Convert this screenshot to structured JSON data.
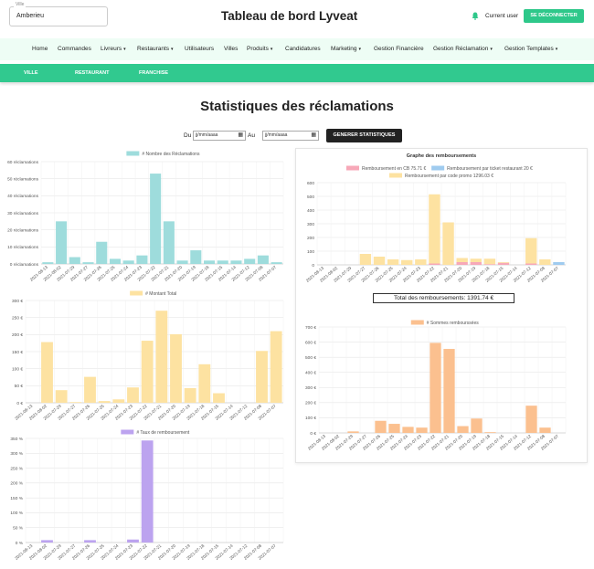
{
  "header": {
    "ville_legend": "Ville",
    "ville_value": "Amberieu",
    "title": "Tableau de bord Lyveat",
    "user": "Current user",
    "logout": "SE DÉCONNECTER"
  },
  "nav": [
    {
      "label": "Home",
      "caret": false
    },
    {
      "label": "Commandes",
      "caret": false
    },
    {
      "label": "Livreurs",
      "caret": true
    },
    {
      "label": "Restaurants",
      "caret": true
    },
    {
      "label": "Utilisateurs",
      "caret": false
    },
    {
      "label": "Villes",
      "caret": false
    },
    {
      "label": "Produits",
      "caret": true
    },
    {
      "label": "Candidatures",
      "caret": false
    },
    {
      "label": "Marketing",
      "caret": true
    },
    {
      "label": "Gestion Financière",
      "caret": false
    },
    {
      "label": "Gestion Réclamation",
      "caret": true
    },
    {
      "label": "Gestion Templates",
      "caret": true
    }
  ],
  "subnav": [
    "VILLE",
    "RESTAURANT",
    "FRANCHISE"
  ],
  "page_title": "Statistiques des réclamations",
  "filters": {
    "du": "Du",
    "au": "Au",
    "date_placeholder": "jj/mm/aaaa",
    "button": "GENERER STATISTIQUES"
  },
  "colors": {
    "teal": "#9edcdc",
    "yellow": "#fde2a1",
    "purple": "#bca3ef",
    "pink": "#f7a8b8",
    "blue": "#9fcbef",
    "orange": "#fbc08f",
    "accent": "#2ec88a"
  },
  "total_label": "Total des remboursements: 1391.74 €",
  "chart_data": [
    {
      "type": "bar",
      "legend": [
        "# Nombre des Réclamations"
      ],
      "categories": [
        "2021-08-13",
        "2021-08-02",
        "2021-07-29",
        "2021-07-27",
        "2021-07-26",
        "2021-07-25",
        "2021-07-24",
        "2021-07-23",
        "2021-07-22",
        "2021-07-21",
        "2021-07-20",
        "2021-07-19",
        "2021-07-18",
        "2021-07-15",
        "2021-07-14",
        "2021-07-12",
        "2021-07-08",
        "2021-07-07"
      ],
      "series": [
        {
          "name": "# Nombre des Réclamations",
          "values": [
            1,
            25,
            4,
            1,
            13,
            3,
            2,
            5,
            53,
            25,
            2,
            8,
            2,
            2,
            2,
            3,
            5,
            1
          ]
        }
      ],
      "yticks": [
        "0 réclamations",
        "10 réclamations",
        "20 réclamations",
        "30 réclamations",
        "40 réclamations",
        "50 réclamations",
        "60 réclamations"
      ],
      "ylim": [
        0,
        60
      ]
    },
    {
      "type": "bar",
      "legend": [
        "# Montant Total"
      ],
      "categories": [
        "2021-08-13",
        "2021-08-02",
        "2021-07-29",
        "2021-07-27",
        "2021-07-26",
        "2021-07-25",
        "2021-07-24",
        "2021-07-23",
        "2021-07-22",
        "2021-07-21",
        "2021-07-20",
        "2021-07-19",
        "2021-07-18",
        "2021-07-15",
        "2021-07-14",
        "2021-07-12",
        "2021-07-08",
        "2021-07-07"
      ],
      "series": [
        {
          "name": "# Montant Total",
          "values": [
            0,
            178,
            37,
            2,
            76,
            5,
            10,
            45,
            182,
            270,
            201,
            43,
            113,
            28,
            0,
            0,
            152,
            210
          ]
        }
      ],
      "yticks": [
        "0 €",
        "50 €",
        "100 €",
        "150 €",
        "200 €",
        "250 €",
        "300 €"
      ],
      "ylim": [
        0,
        300
      ]
    },
    {
      "type": "bar",
      "legend": [
        "# Taux de remboursement"
      ],
      "categories": [
        "2021-08-13",
        "2021-08-02",
        "2021-07-29",
        "2021-07-27",
        "2021-07-26",
        "2021-07-25",
        "2021-07-24",
        "2021-07-23",
        "2021-07-22",
        "2021-07-21",
        "2021-07-20",
        "2021-07-19",
        "2021-07-18",
        "2021-07-15",
        "2021-07-14",
        "2021-07-12",
        "2021-07-08",
        "2021-07-07"
      ],
      "series": [
        {
          "name": "# Taux de remboursement",
          "values": [
            0,
            8,
            0,
            0,
            8,
            0,
            0,
            10,
            343,
            0,
            0,
            0,
            0,
            0,
            0,
            0,
            0,
            0
          ]
        }
      ],
      "yticks": [
        "0 %",
        "50 %",
        "100 %",
        "150 %",
        "200 %",
        "250 %",
        "300 %",
        "350 %"
      ],
      "ylim": [
        0,
        350
      ]
    },
    {
      "type": "bar",
      "stacked": true,
      "title": "Graphe des remboursements",
      "legend": [
        "Remboursement en CB 75.71 €",
        "Remboursement par ticket restaurant 20 €",
        "Remboursement par code promo 1296.03 €"
      ],
      "categories": [
        "2021-08-13",
        "2021-08-02",
        "2021-07-29",
        "2021-07-27",
        "2021-07-26",
        "2021-07-25",
        "2021-07-24",
        "2021-07-23",
        "2021-07-22",
        "2021-07-21",
        "2021-07-20",
        "2021-07-19",
        "2021-07-18",
        "2021-07-15",
        "2021-07-14",
        "2021-07-12",
        "2021-07-08",
        "2021-07-07"
      ],
      "series": [
        {
          "name": "Remboursement en CB 75.71 €",
          "values": [
            0,
            0,
            0,
            0,
            0,
            0,
            0,
            0,
            10,
            0,
            20,
            20,
            5,
            15,
            0,
            10,
            0,
            0
          ]
        },
        {
          "name": "Remboursement par ticket restaurant 20 €",
          "values": [
            0,
            0,
            0,
            0,
            0,
            0,
            0,
            0,
            0,
            0,
            0,
            0,
            0,
            0,
            0,
            0,
            0,
            20
          ]
        },
        {
          "name": "Remboursement par code promo 1296.03 €",
          "values": [
            0,
            0,
            0,
            80,
            60,
            40,
            35,
            40,
            505,
            310,
            30,
            25,
            40,
            5,
            0,
            185,
            40,
            0
          ]
        }
      ],
      "yticks": [
        "0",
        "100",
        "200",
        "300",
        "400",
        "500",
        "600"
      ],
      "ylim": [
        0,
        600
      ]
    },
    {
      "type": "bar",
      "legend": [
        "# Sommes rembourssées"
      ],
      "categories": [
        "2021-08-13",
        "2021-08-02",
        "2021-07-29",
        "2021-07-27",
        "2021-07-26",
        "2021-07-25",
        "2021-07-24",
        "2021-07-23",
        "2021-07-22",
        "2021-07-21",
        "2021-07-20",
        "2021-07-19",
        "2021-07-18",
        "2021-07-15",
        "2021-07-14",
        "2021-07-12",
        "2021-07-08",
        "2021-07-07"
      ],
      "series": [
        {
          "name": "# Sommes rembourssées",
          "values": [
            0,
            0,
            10,
            0,
            80,
            60,
            40,
            35,
            595,
            555,
            45,
            95,
            5,
            0,
            0,
            180,
            35,
            0
          ]
        }
      ],
      "yticks": [
        "0 €",
        "100 €",
        "200 €",
        "300 €",
        "400 €",
        "500 €",
        "600 €",
        "700 €"
      ],
      "ylim": [
        0,
        700
      ]
    }
  ]
}
